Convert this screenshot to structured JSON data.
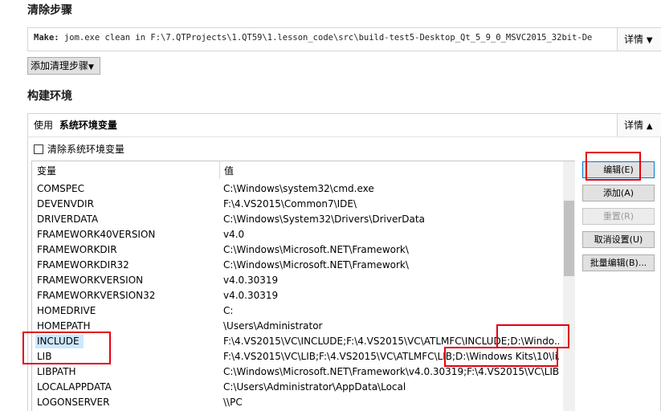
{
  "clean_steps": {
    "title": "清除步骤",
    "make_label": "Make:",
    "command": " jom.exe clean in F:\\7.QTProjects\\1.QT59\\1.lesson_code\\src\\build-test5-Desktop_Qt_5_9_0_MSVC2015_32bit-De",
    "details_label": "详情",
    "add_step_label": "添加清理步骤"
  },
  "build_env": {
    "title": "构建环境",
    "use_label": "使用",
    "env_name": "系统环境变量",
    "details_label": "详情",
    "clear_label": "清除系统环境变量",
    "clear_checked": false,
    "columns": [
      "变量",
      "值"
    ],
    "rows": [
      {
        "name": "COMSPEC",
        "value": "C:\\Windows\\system32\\cmd.exe"
      },
      {
        "name": "DEVENVDIR",
        "value": "F:\\4.VS2015\\Common7\\IDE\\"
      },
      {
        "name": "DRIVERDATA",
        "value": "C:\\Windows\\System32\\Drivers\\DriverData"
      },
      {
        "name": "FRAMEWORK40VERSION",
        "value": "v4.0"
      },
      {
        "name": "FRAMEWORKDIR",
        "value": "C:\\Windows\\Microsoft.NET\\Framework\\"
      },
      {
        "name": "FRAMEWORKDIR32",
        "value": "C:\\Windows\\Microsoft.NET\\Framework\\"
      },
      {
        "name": "FRAMEWORKVERSION",
        "value": "v4.0.30319"
      },
      {
        "name": "FRAMEWORKVERSION32",
        "value": "v4.0.30319"
      },
      {
        "name": "HOMEDRIVE",
        "value": "C:"
      },
      {
        "name": "HOMEPATH",
        "value": "\\Users\\Administrator"
      },
      {
        "name": "INCLUDE",
        "value": "F:\\4.VS2015\\VC\\INCLUDE;F:\\4.VS2015\\VC\\ATLMFC\\INCLUDE;D:\\Windo..."
      },
      {
        "name": "LIB",
        "value": "F:\\4.VS2015\\VC\\LIB;F:\\4.VS2015\\VC\\ATLMFC\\LIB;D:\\Windows Kits\\10\\li..."
      },
      {
        "name": "LIBPATH",
        "value": "C:\\Windows\\Microsoft.NET\\Framework\\v4.0.30319;F:\\4.VS2015\\VC\\LIB..."
      },
      {
        "name": "LOCALAPPDATA",
        "value": "C:\\Users\\Administrator\\AppData\\Local"
      },
      {
        "name": "LOGONSERVER",
        "value": "\\\\PC"
      }
    ],
    "selected_row": "INCLUDE",
    "buttons": {
      "edit": "编辑(E)",
      "add": "添加(A)",
      "reset": "重置(R)",
      "unset": "取消设置(U)",
      "batch_edit": "批量编辑(B)..."
    }
  },
  "colors": {
    "highlight_red": "#e3000f",
    "selection_bg": "#cce8ff"
  }
}
